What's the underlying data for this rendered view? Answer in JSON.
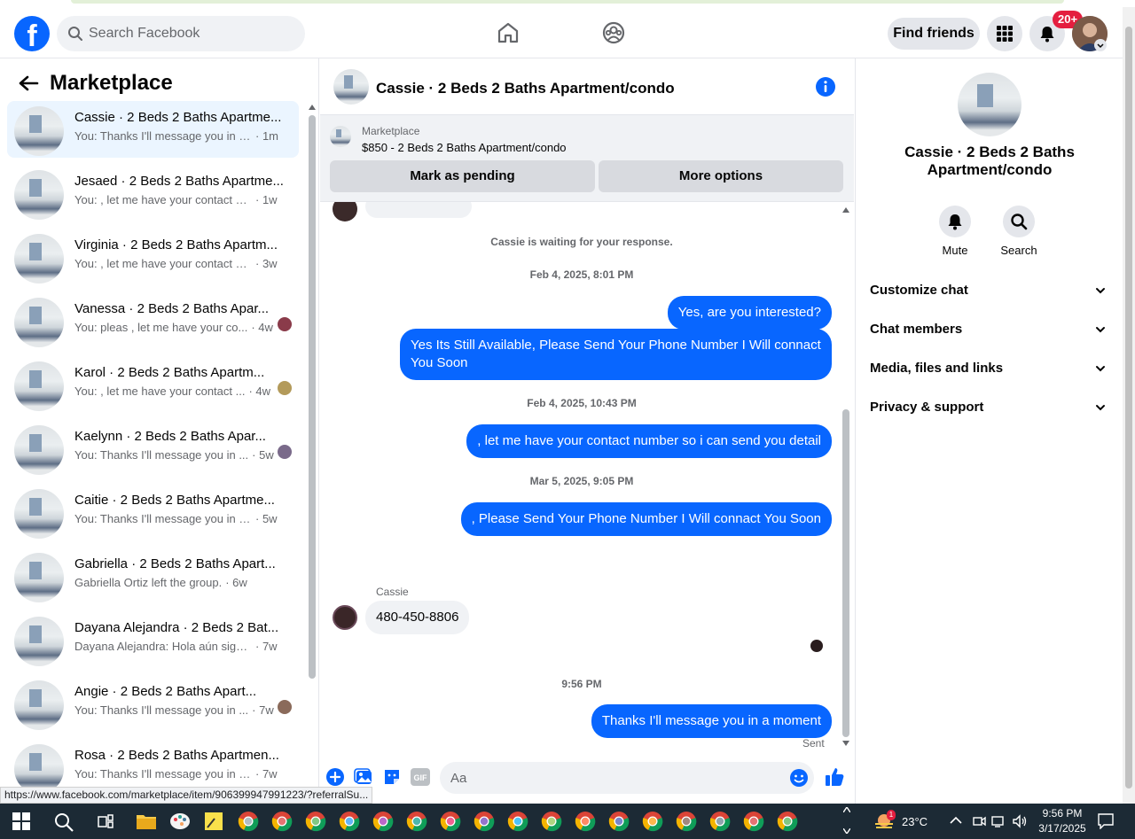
{
  "header": {
    "search_placeholder": "Search Facebook",
    "find_friends": "Find friends",
    "notif_badge": "20+"
  },
  "left": {
    "title": "Marketplace",
    "conversations": [
      {
        "name": "Cassie · 2 Beds 2 Baths Apartme...",
        "snippet": "You: Thanks I'll message you in a ...",
        "time": "· 1m",
        "active": true
      },
      {
        "name": "Jesaed · 2 Beds 2 Baths Apartme...",
        "snippet": "You: , let me have your contact nu...",
        "time": "· 1w"
      },
      {
        "name": "Virginia · 2 Beds 2 Baths Apartm...",
        "snippet": "You: , let me have your contact nu...",
        "time": "· 3w"
      },
      {
        "name": "Vanessa · 2 Beds 2 Baths Apar...",
        "snippet": "You: pleas , let me have your co...",
        "time": "· 4w"
      },
      {
        "name": "Karol · 2 Beds 2 Baths Apartm...",
        "snippet": "You: , let me have your contact ...",
        "time": "· 4w"
      },
      {
        "name": "Kaelynn · 2 Beds 2 Baths Apar...",
        "snippet": "You: Thanks I'll message you in ...",
        "time": "· 5w"
      },
      {
        "name": "Caitie · 2 Beds 2 Baths Apartme...",
        "snippet": "You: Thanks I'll message you in a ...",
        "time": "· 5w"
      },
      {
        "name": "Gabriella · 2 Beds 2 Baths Apart...",
        "snippet": "Gabriella Ortiz left the group.",
        "time": "· 6w"
      },
      {
        "name": "Dayana Alejandra · 2 Beds 2 Bat...",
        "snippet": "Dayana Alejandra: Hola aún sigue ...",
        "time": "· 7w"
      },
      {
        "name": "Angie · 2 Beds 2 Baths Apart...",
        "snippet": "You: Thanks I'll message you in ...",
        "time": "· 7w"
      },
      {
        "name": "Rosa · 2 Beds 2 Baths Apartmen...",
        "snippet": "You: Thanks I'll message you in a ...",
        "time": "· 7w"
      }
    ]
  },
  "chat": {
    "title": "Cassie · 2 Beds 2 Baths Apartment/condo",
    "marketplace_label": "Marketplace",
    "listing": "$850 - 2 Beds 2 Baths Apartment/condo",
    "mark_pending": "Mark as pending",
    "more_options": "More options",
    "waiting": "Cassie is waiting for your response.",
    "ts1": "Feb 4, 2025, 8:01 PM",
    "m1": "Yes, are you interested?",
    "m2": "Yes Its Still Available, Please Send Your Phone Number I Will connact You Soon",
    "ts2": "Feb 4, 2025, 10:43 PM",
    "m3": ", let me have your contact number so i can send you detail",
    "ts3": "Mar 5, 2025, 9:05 PM",
    "m4": ", Please Send Your Phone Number I Will connact You Soon",
    "sender": "Cassie",
    "m5": "480-450-8806",
    "ts4": "9:56 PM",
    "m6": "Thanks I'll message you in a moment",
    "sent": "Sent",
    "composer_placeholder": "Aa"
  },
  "right": {
    "title": "Cassie · 2 Beds 2 Baths Apartment/condo",
    "mute": "Mute",
    "search": "Search",
    "items": [
      "Customize chat",
      "Chat members",
      "Media, files and links",
      "Privacy & support"
    ]
  },
  "status_url": "https://www.facebook.com/marketplace/item/906399947991223/?referralSu...",
  "taskbar": {
    "temp": "23°C",
    "time": "9:56 PM",
    "date": "3/17/2025",
    "weather_badge": "1"
  },
  "colors": {
    "accent": "#0866ff",
    "badge": "#e41e3f"
  }
}
